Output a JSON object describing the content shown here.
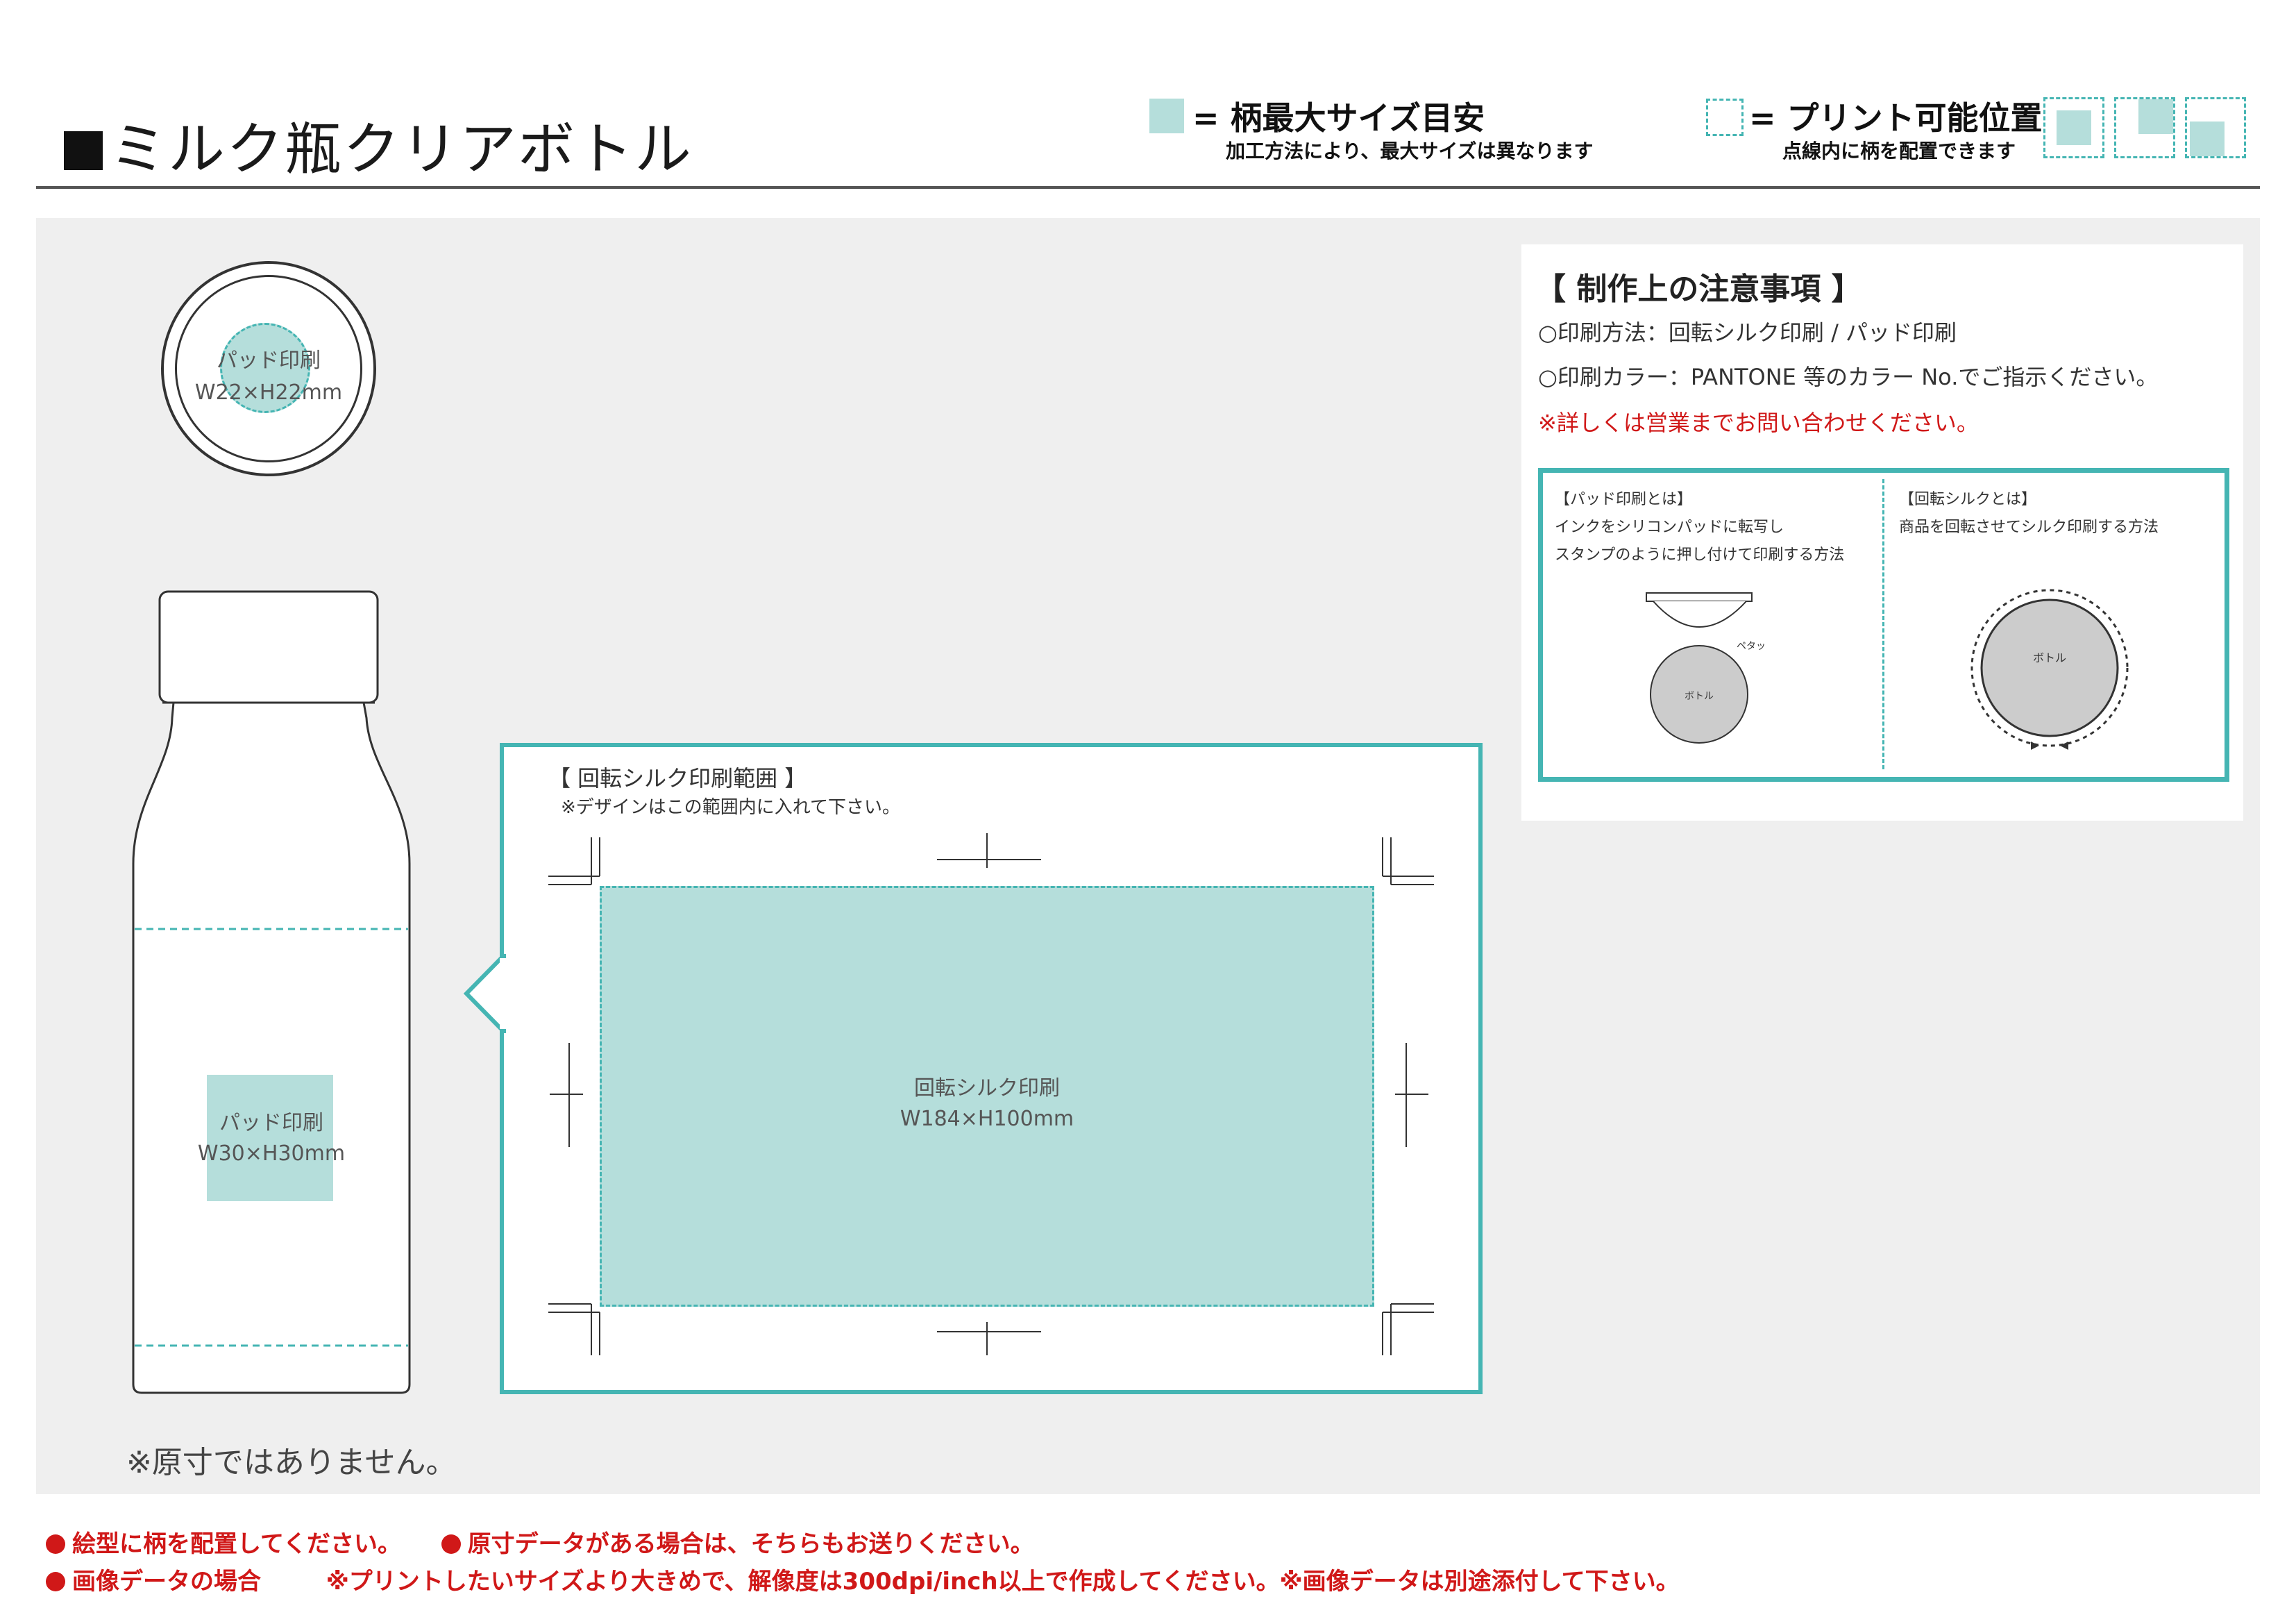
{
  "header": {
    "title": "ミルク瓶クリアボトル",
    "legend_max": {
      "label": "= 柄最大サイズ目安",
      "sub": "加工方法により、最大サイズは異なります"
    },
    "legend_print": {
      "label": "= プリント可能位置",
      "sub": "点線内に柄を配置できます"
    }
  },
  "colors": {
    "accent": "#45b5b3",
    "fill": "#b5dedb",
    "red": "#d01818",
    "gray_bg": "#efefef"
  },
  "cap_print": {
    "label": "パッド印刷",
    "size": "W22×H22mm"
  },
  "body_print": {
    "label": "パッド印刷",
    "size": "W30×H30mm"
  },
  "silk": {
    "heading": "【 回転シルク印刷範囲 】",
    "note": "※デザインはこの範囲内に入れて下さい。",
    "label": "回転シルク印刷",
    "size": "W184×H100mm"
  },
  "not_actual_size": "※原寸ではありません。",
  "notes": {
    "title": "【 制作上の注意事項 】",
    "method": "○印刷方法：回転シルク印刷 / パッド印刷",
    "color": "○印刷カラー：PANTONE 等のカラー No.でご指示ください。",
    "contact": "※詳しくは営業までお問い合わせください。"
  },
  "explain": {
    "pad_title": "【パッド印刷とは】",
    "pad_line1": "インクをシリコンパッドに転写し",
    "pad_line2": "スタンプのように押し付けて印刷する方法",
    "pad_sfx": "ペタッ",
    "pad_bottle": "ボトル",
    "silk_title": "【回転シルクとは】",
    "silk_line1": "商品を回転させてシルク印刷する方法",
    "silk_bottle": "ボトル"
  },
  "footer": {
    "line1a": "絵型に柄を配置してください。",
    "line1b": "原寸データがある場合は、そちらもお送りください。",
    "line2a": "画像データの場合",
    "line2b": "※プリントしたいサイズより大きめで、解像度は300dpi/inch以上で作成してください。※画像データは別途添付して下さい。"
  }
}
